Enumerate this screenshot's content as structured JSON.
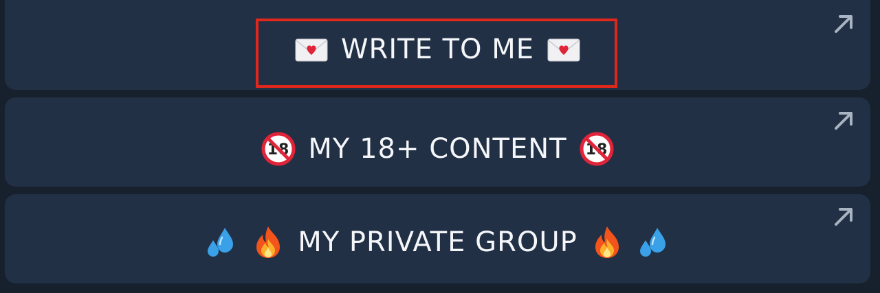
{
  "buttons": [
    {
      "label": "WRITE TO ME",
      "left_icons": [
        "love-letter-icon"
      ],
      "right_icons": [
        "love-letter-icon"
      ],
      "highlighted": true
    },
    {
      "label": "MY 18+ CONTENT",
      "left_icons": [
        "no-one-under-eighteen-icon"
      ],
      "right_icons": [
        "no-one-under-eighteen-icon"
      ],
      "highlighted": false
    },
    {
      "label": "MY PRIVATE GROUP",
      "left_icons": [
        "sweat-droplets-icon",
        "fire-icon"
      ],
      "right_icons": [
        "fire-icon",
        "sweat-droplets-icon"
      ],
      "highlighted": false
    }
  ],
  "colors": {
    "background": "#17212e",
    "button": "#223045",
    "text": "#f4f6f9",
    "highlight": "#e0271c",
    "arrow": "#a9b4c2"
  },
  "badge": {
    "eighteen": "18"
  }
}
